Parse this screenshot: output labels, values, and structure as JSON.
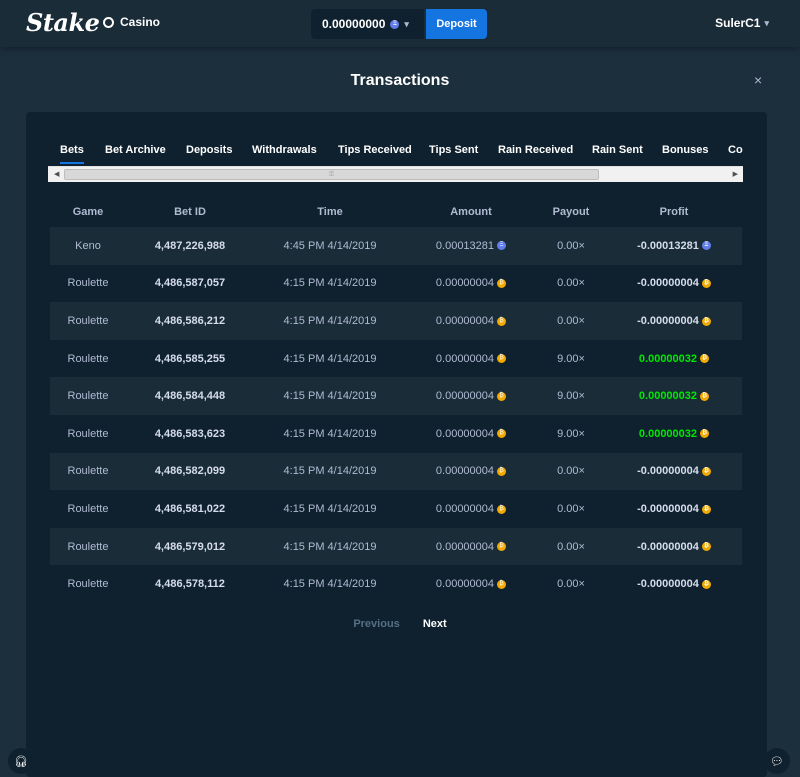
{
  "header": {
    "logo": "Stake",
    "nav_casino": "Casino",
    "balance": "0.00000000",
    "deposit_label": "Deposit",
    "username": "SulerC1"
  },
  "modal": {
    "title": "Transactions",
    "close": "×"
  },
  "tabs": [
    {
      "label": "Bets",
      "active": true
    },
    {
      "label": "Bet Archive"
    },
    {
      "label": "Deposits"
    },
    {
      "label": "Withdrawals"
    },
    {
      "label": "Tips Received"
    },
    {
      "label": "Tips Sent"
    },
    {
      "label": "Rain Received"
    },
    {
      "label": "Rain Sent"
    },
    {
      "label": "Bonuses"
    },
    {
      "label": "Co"
    }
  ],
  "table": {
    "columns": [
      "Game",
      "Bet ID",
      "Time",
      "Amount",
      "Payout",
      "Profit"
    ],
    "rows": [
      {
        "game": "Keno",
        "bet_id": "4,487,226,988",
        "time": "4:45 PM 4/14/2019",
        "amount": "0.00013281",
        "currency": "eth",
        "payout": "0.00×",
        "profit": "-0.00013281",
        "win": false
      },
      {
        "game": "Roulette",
        "bet_id": "4,486,587,057",
        "time": "4:15 PM 4/14/2019",
        "amount": "0.00000004",
        "currency": "btc",
        "payout": "0.00×",
        "profit": "-0.00000004",
        "win": false
      },
      {
        "game": "Roulette",
        "bet_id": "4,486,586,212",
        "time": "4:15 PM 4/14/2019",
        "amount": "0.00000004",
        "currency": "btc",
        "payout": "0.00×",
        "profit": "-0.00000004",
        "win": false
      },
      {
        "game": "Roulette",
        "bet_id": "4,486,585,255",
        "time": "4:15 PM 4/14/2019",
        "amount": "0.00000004",
        "currency": "btc",
        "payout": "9.00×",
        "profit": "0.00000032",
        "win": true
      },
      {
        "game": "Roulette",
        "bet_id": "4,486,584,448",
        "time": "4:15 PM 4/14/2019",
        "amount": "0.00000004",
        "currency": "btc",
        "payout": "9.00×",
        "profit": "0.00000032",
        "win": true
      },
      {
        "game": "Roulette",
        "bet_id": "4,486,583,623",
        "time": "4:15 PM 4/14/2019",
        "amount": "0.00000004",
        "currency": "btc",
        "payout": "9.00×",
        "profit": "0.00000032",
        "win": true
      },
      {
        "game": "Roulette",
        "bet_id": "4,486,582,099",
        "time": "4:15 PM 4/14/2019",
        "amount": "0.00000004",
        "currency": "btc",
        "payout": "0.00×",
        "profit": "-0.00000004",
        "win": false
      },
      {
        "game": "Roulette",
        "bet_id": "4,486,581,022",
        "time": "4:15 PM 4/14/2019",
        "amount": "0.00000004",
        "currency": "btc",
        "payout": "0.00×",
        "profit": "-0.00000004",
        "win": false
      },
      {
        "game": "Roulette",
        "bet_id": "4,486,579,012",
        "time": "4:15 PM 4/14/2019",
        "amount": "0.00000004",
        "currency": "btc",
        "payout": "0.00×",
        "profit": "-0.00000004",
        "win": false
      },
      {
        "game": "Roulette",
        "bet_id": "4,486,578,112",
        "time": "4:15 PM 4/14/2019",
        "amount": "0.00000004",
        "currency": "btc",
        "payout": "0.00×",
        "profit": "-0.00000004",
        "win": false
      }
    ]
  },
  "pagination": {
    "previous": "Previous",
    "next": "Next"
  },
  "icons": {
    "eth_coin": "eth-coin-icon",
    "btc_coin": "btc-coin-icon",
    "support": "headset-icon",
    "chat": "chat-icon"
  },
  "colors": {
    "accent": "#1475e1",
    "win": "#00e701",
    "background": "#1a2c38",
    "panel": "#0f212e"
  }
}
